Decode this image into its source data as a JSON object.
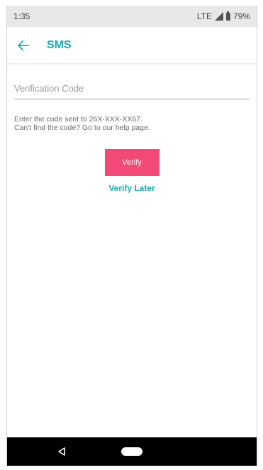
{
  "status_bar": {
    "time": "1:35",
    "network": "LTE",
    "battery": "79%",
    "icons": {
      "signal": "signal-icon",
      "battery": "battery-icon"
    }
  },
  "app_bar": {
    "title": "SMS",
    "back_icon": "arrow-left-icon"
  },
  "form": {
    "code_field": {
      "placeholder": "Verification Code",
      "value": ""
    },
    "instruction_line1": "Enter the code sent to 26X-XXX-XX67.",
    "instruction_line2_prefix": "Can't find the code? ",
    "help_link": "Go to our help page."
  },
  "actions": {
    "verify_label": "Verify",
    "verify_later_label": "Verify Later"
  },
  "nav_bar": {
    "back_icon": "triangle-back-icon",
    "home_icon": "home-pill-icon"
  },
  "colors": {
    "accent": "#1ba9b5",
    "primary_button": "#f24a76",
    "status_bar": "#e8e8e8",
    "nav_bar": "#000000"
  }
}
